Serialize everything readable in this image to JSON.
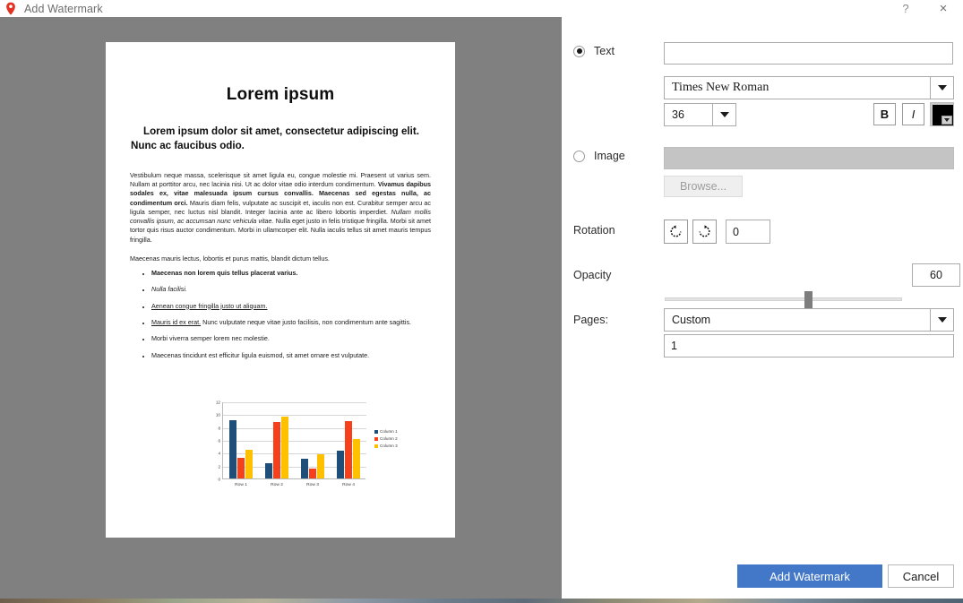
{
  "titlebar": {
    "title": "Add Watermark",
    "pin_icon": "location-pin-icon",
    "help_label": "?",
    "close_label": "×"
  },
  "panel": {
    "text_radio_label": "Text",
    "text_value": "",
    "font_family_value": "Times New Roman",
    "font_size_value": "36",
    "bold_label": "B",
    "italic_label": "I",
    "color_value": "#000000",
    "image_radio_label": "Image",
    "image_path_value": "",
    "browse_label": "Browse...",
    "rotation_label": "Rotation",
    "rotate_ccw_icon": "rotate-counterclockwise-icon",
    "rotate_cw_icon": "rotate-clockwise-icon",
    "rotation_value": "0",
    "opacity_label": "Opacity",
    "opacity_value": "60",
    "pages_label": "Pages:",
    "pages_value": "Custom",
    "pages_custom_value": "1"
  },
  "footer": {
    "primary_label": "Add Watermark",
    "secondary_label": "Cancel",
    "primary_color": "#4378c8"
  },
  "document": {
    "title": "Lorem ipsum",
    "subtitle": "Lorem ipsum dolor sit amet, consectetur adipiscing elit. Nunc ac faucibus odio.",
    "body_1a": "Vestibulum neque massa, scelerisque sit amet ligula eu, congue molestie mi. Praesent ut varius sem. Nullam at porttitor arcu, nec lacinia nisi. Ut ac dolor vitae odio interdum condimentum. ",
    "body_1b_bold": "Vivamus dapibus sodales ex, vitae malesuada ipsum cursus convallis. Maecenas sed egestas nulla, ac condimentum orci.",
    "body_1c": " Mauris diam felis, vulputate ac suscipit et, iaculis non est. Curabitur semper arcu ac ligula semper, nec luctus nisl blandit. Integer lacinia ante ac libero lobortis imperdiet. ",
    "body_1d_italic": "Nullam mollis convallis ipsum, ac accumsan nunc vehicula vitae.",
    "body_1e": " Nulla eget justo in felis tristique fringilla. Morbi sit amet tortor quis risus auctor condimentum. Morbi in ullamcorper elit. Nulla iaculis tellus sit amet mauris tempus fringilla.",
    "body_2": "Maecenas mauris lectus, lobortis et purus mattis, blandit dictum tellus.",
    "bullets": [
      {
        "text": "Maecenas non lorem quis tellus placerat varius.",
        "style": "bold"
      },
      {
        "text": "Nulla facilisi.",
        "style": "italic"
      },
      {
        "text": "Aenean congue fringilla justo ut aliquam. ",
        "style": "underline"
      },
      {
        "text": "Mauris id ex erat.",
        "style": "underline",
        "rest": " Nunc vulputate neque vitae justo facilisis, non condimentum ante sagittis."
      },
      {
        "text": "Morbi viverra semper lorem nec molestie.",
        "style": "normal"
      },
      {
        "text": "Maecenas tincidunt est efficitur ligula euismod, sit amet ornare est vulputate.",
        "style": "normal"
      }
    ]
  },
  "chart_data": {
    "type": "bar",
    "title": "",
    "xlabel": "",
    "ylabel": "",
    "categories": [
      "Row 1",
      "Row 2",
      "Row 3",
      "Row 4"
    ],
    "series": [
      {
        "name": "Column 1",
        "color": "#1f4e79",
        "values": [
          9.1,
          2.4,
          3.1,
          4.3
        ]
      },
      {
        "name": "Column 2",
        "color": "#f5401b",
        "values": [
          3.2,
          8.8,
          1.5,
          9.0
        ]
      },
      {
        "name": "Column 3",
        "color": "#ffc000",
        "values": [
          4.5,
          9.6,
          3.7,
          6.2
        ]
      }
    ],
    "ylim": [
      0,
      12
    ],
    "yticks": [
      0,
      2,
      4,
      6,
      8,
      10,
      12
    ],
    "grid": true,
    "legend_position": "right"
  }
}
